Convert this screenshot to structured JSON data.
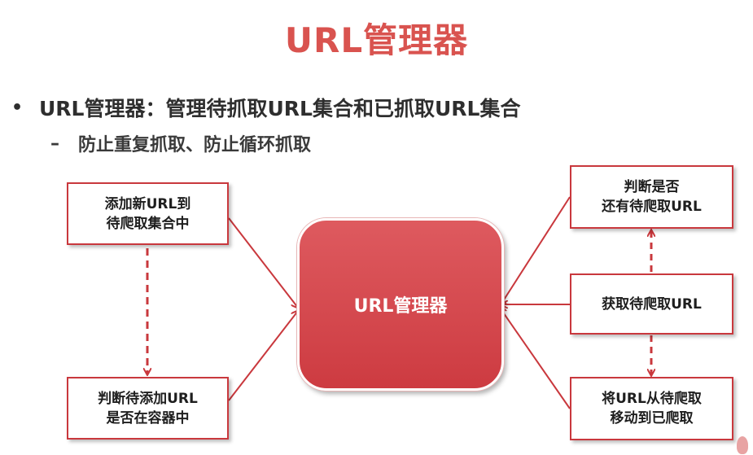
{
  "title": "URL管理器",
  "bullet": {
    "marker": "•",
    "text": "URL管理器：管理待抓取URL集合和已抓取URL集合"
  },
  "sub_bullet": {
    "marker": "–",
    "text": "防止重复抓取、防止循环抓取"
  },
  "diagram": {
    "center_label": "URL管理器",
    "left_boxes": [
      {
        "line1": "添加新URL到",
        "line2": "待爬取集合中"
      },
      {
        "line1": "判断待添加URL",
        "line2": "是否在容器中"
      }
    ],
    "right_boxes": [
      {
        "line1": "判断是否",
        "line2": "还有待爬取URL"
      },
      {
        "line1": "获取待爬取URL",
        "line2": ""
      },
      {
        "line1": "将URL从待爬取",
        "line2": "移动到已爬取"
      }
    ]
  },
  "colors": {
    "accent": "#d9534f",
    "center_fill": "#d2444a",
    "box_border": "#c9383d",
    "arrow": "#c9383d"
  }
}
